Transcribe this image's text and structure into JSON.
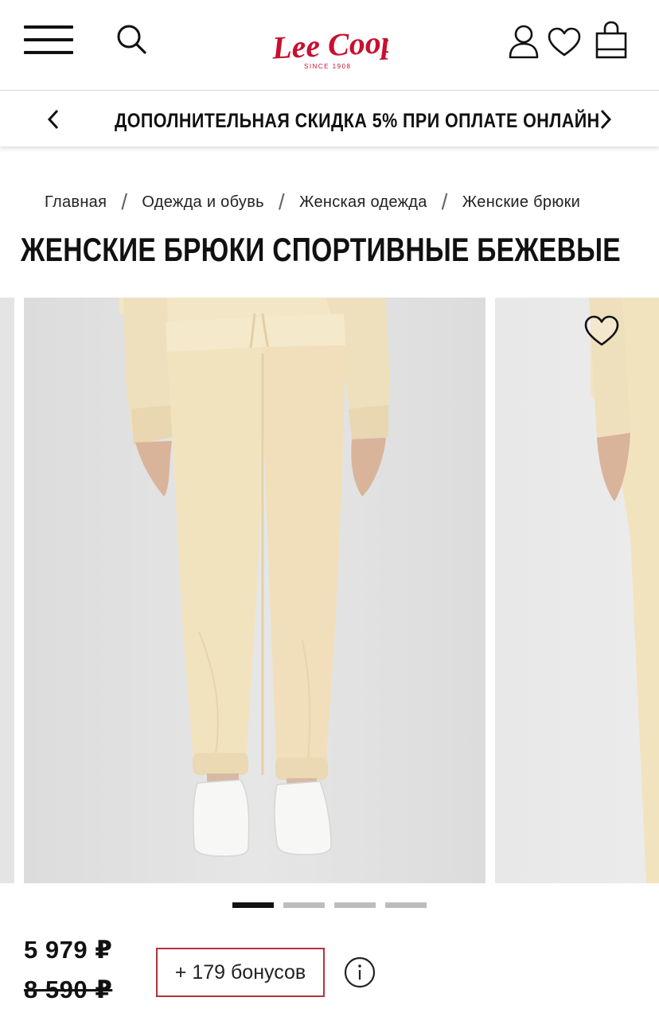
{
  "header": {
    "logo_text": "Lee Cooper",
    "logo_sub": "SINCE 1908",
    "logo_color": "#c8102e"
  },
  "promo": {
    "text": "ДОПОЛНИТЕЛЬНАЯ СКИДКА 5% ПРИ ОПЛАТЕ ОНЛАЙН"
  },
  "breadcrumb": {
    "items": [
      "Главная",
      "Одежда и обувь",
      "Женская одежда",
      "Женские брюки"
    ],
    "separator": "/"
  },
  "product": {
    "title": "ЖЕНСКИЕ БРЮКИ СПОРТИВНЫЕ БЕЖЕВЫЕ",
    "price_current": "5 979 ₽",
    "price_old": "8 590 ₽",
    "bonus": "+ 179 бонусов",
    "image_color": "#f1e2bf"
  },
  "gallery": {
    "slides_total": 4,
    "active_index": 0
  },
  "colors": {
    "accent_border": "#b5323c",
    "text": "#111111"
  }
}
